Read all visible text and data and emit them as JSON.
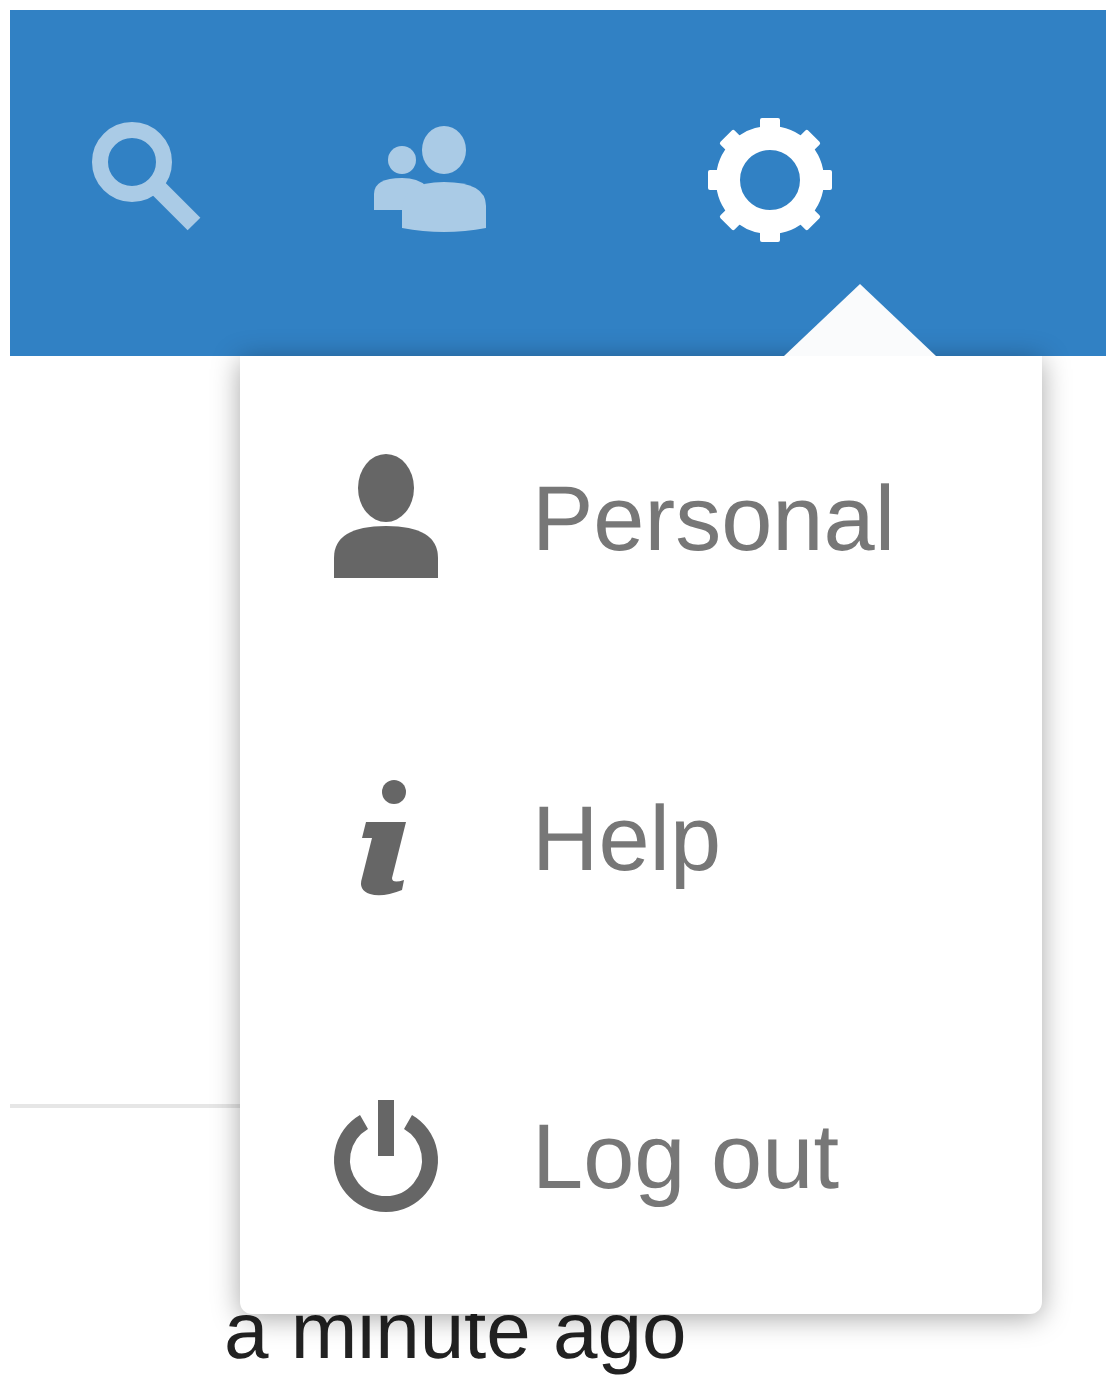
{
  "header": {
    "buttons": [
      {
        "kind": "search",
        "selected": false
      },
      {
        "kind": "contacts",
        "selected": false
      },
      {
        "kind": "settings",
        "selected": true
      }
    ]
  },
  "menu": {
    "items": [
      {
        "kind": "person",
        "label": "Personal"
      },
      {
        "kind": "info",
        "label": "Help"
      },
      {
        "kind": "power",
        "label": "Log out"
      }
    ]
  },
  "activity": {
    "time": "a minute ago"
  }
}
